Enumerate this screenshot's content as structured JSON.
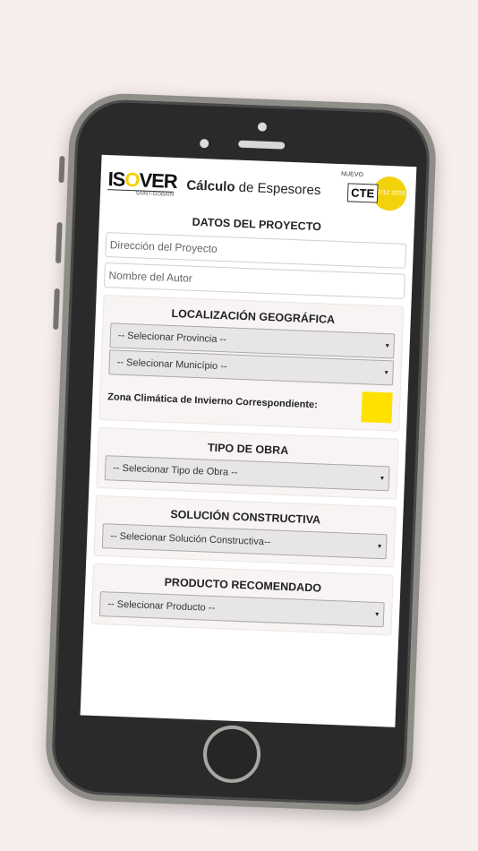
{
  "header": {
    "logo_text_1": "IS",
    "logo_text_o": "O",
    "logo_text_2": "VER",
    "logo_sub": "SAINT-GOBAIN",
    "title_bold": "Cálculo",
    "title_rest": " de Espesores",
    "cte_nuevo": "NUEVO",
    "cte_label": "CTE",
    "cte_badge": "27/12 2019"
  },
  "project": {
    "title": "DATOS DEL PROYECTO",
    "address_placeholder": "Dirección del Proyecto",
    "author_placeholder": "Nombre del Autor"
  },
  "location": {
    "title": "LOCALIZACIÓN GEOGRÁFICA",
    "province_select": "-- Selecionar Provincia --",
    "municipality_select": "-- Selecionar Município --",
    "zone_label": "Zona Climática de Invierno Correspondiente:",
    "zone_color": "#ffe100"
  },
  "work_type": {
    "title": "TIPO DE OBRA",
    "select": "-- Selecionar Tipo de Obra --"
  },
  "solution": {
    "title": "SOLUCIÓN CONSTRUCTIVA",
    "select": "-- Selecionar Solución Constructiva--"
  },
  "product": {
    "title": "PRODUCTO RECOMENDADO",
    "select": "-- Selecionar Producto --"
  },
  "icons": {
    "caret": "▾"
  }
}
